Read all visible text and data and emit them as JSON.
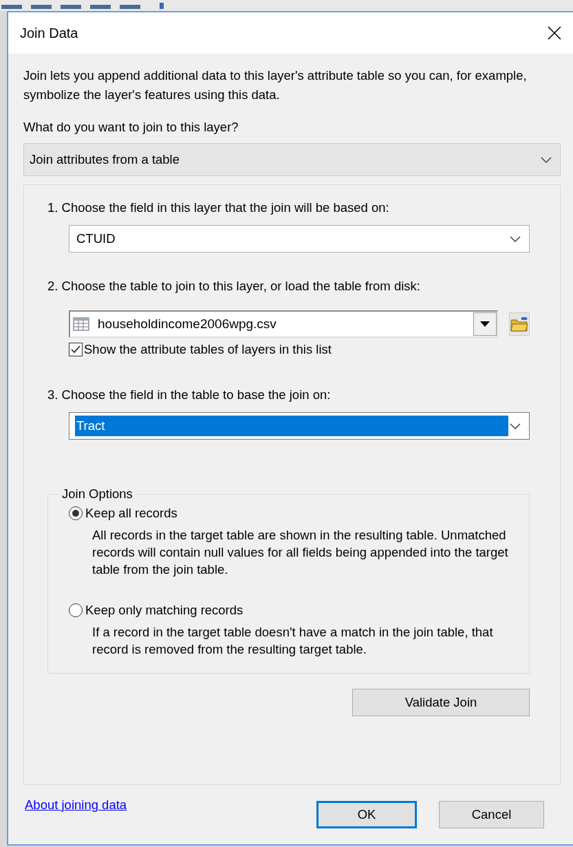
{
  "window": {
    "title": "Join Data"
  },
  "description": "Join lets you append additional data to this layer's attribute table so you can, for example, symbolize the layer's features using this data.",
  "join_type": {
    "label": "What do you want to join to this layer?",
    "value": "Join attributes from a table"
  },
  "steps": [
    {
      "kind": "combo",
      "label": "1.  Choose the field in this layer that the join will be based on:",
      "value": "CTUID",
      "highlighted": false
    },
    {
      "kind": "table",
      "label": "2.  Choose the table to join to this layer, or load the table from disk:",
      "value": "householdincome2006wpg.csv",
      "checkbox": {
        "label": "Show the attribute tables of layers in this list",
        "checked": true
      }
    },
    {
      "kind": "combo",
      "label": "3.  Choose the field in the table to base the join on:",
      "value": "Tract",
      "highlighted": true
    }
  ],
  "join_options": {
    "title": "Join Options",
    "options": [
      {
        "label": "Keep all records",
        "description": "All records in the target table are shown in the resulting table. Unmatched records will contain null values for all fields being appended into the target table from the join table.",
        "selected": true
      },
      {
        "label": "Keep only matching records",
        "description": "If a record in the target table doesn't have a match in the join table, that record is removed from the resulting target table.",
        "selected": false
      }
    ]
  },
  "validate_button": "Validate Join",
  "help_link": "About joining data",
  "buttons": [
    {
      "label": "OK",
      "default": true
    },
    {
      "label": "Cancel",
      "default": false
    }
  ]
}
